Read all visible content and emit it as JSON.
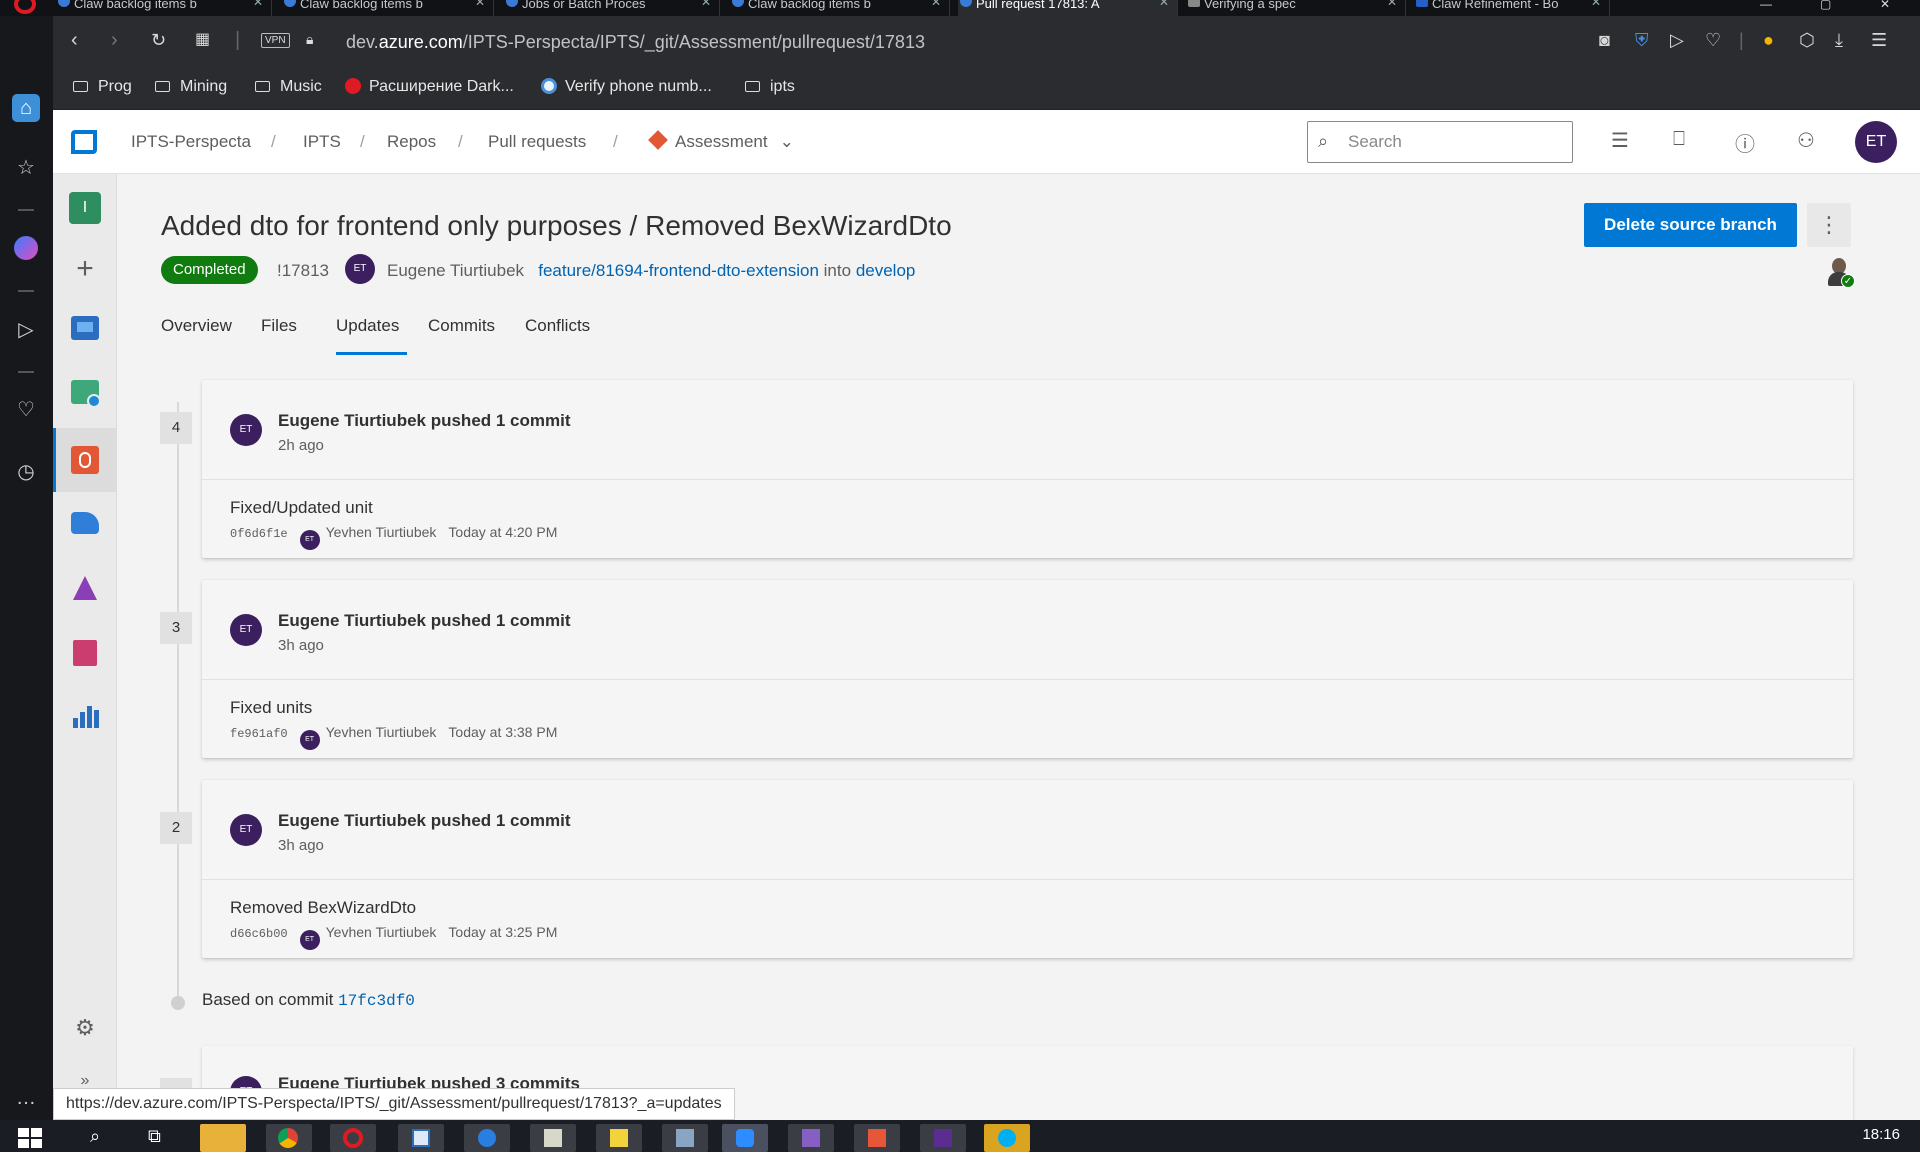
{
  "browser": {
    "tabs": [
      {
        "title": "Claw backlog items b"
      },
      {
        "title": "Claw backlog items b"
      },
      {
        "title": "Jobs or Batch Proces"
      },
      {
        "title": "Claw backlog items b"
      },
      {
        "title": "Pull request 17813: A"
      },
      {
        "title": "Verifying a spec"
      },
      {
        "title": "Claw Refinement - Bo"
      }
    ],
    "address": {
      "prefix": "dev.",
      "domain": "azure.com",
      "path": "/IPTS-Perspecta/IPTS/_git/Assessment/pullrequest/17813",
      "vpn_label": "VPN"
    },
    "bookmarks": [
      {
        "label": "Prog",
        "icon": "folder-icon"
      },
      {
        "label": "Mining",
        "icon": "folder-icon"
      },
      {
        "label": "Music",
        "icon": "folder-icon"
      },
      {
        "label": "Расширение Dark...",
        "icon": "opera-icon"
      },
      {
        "label": "Verify phone numb...",
        "icon": "telegram-icon"
      },
      {
        "label": "ipts",
        "icon": "folder-icon"
      }
    ],
    "status_url": "https://dev.azure.com/IPTS-Perspecta/IPTS/_git/Assessment/pullrequest/17813?_a=updates"
  },
  "header": {
    "breadcrumb": [
      "IPTS-Perspecta",
      "IPTS",
      "Repos",
      "Pull requests",
      "Assessment"
    ],
    "search_placeholder": "Search",
    "user_initials": "ET"
  },
  "nav": {
    "project_initial": "I"
  },
  "pr": {
    "title": "Added dto for frontend only purposes / Removed BexWizardDto",
    "status": "Completed",
    "id": "!17813",
    "author_initials": "ET",
    "author": "Eugene Tiurtiubek",
    "source_branch": "feature/81694-frontend-dto-extension",
    "into": "into",
    "target_branch": "develop",
    "delete_button": "Delete source branch",
    "more_label": "⋮"
  },
  "tabs": [
    "Overview",
    "Files",
    "Updates",
    "Commits",
    "Conflicts"
  ],
  "updates": [
    {
      "number": "4",
      "initials": "ET",
      "headline": "Eugene Tiurtiubek pushed 1 commit",
      "ago": "2h ago",
      "commit_message": "Fixed/Updated unit",
      "sha": "0f6d6f1e",
      "committer": "Yevhen Tiurtiubek",
      "when": "Today at 4:20 PM"
    },
    {
      "number": "3",
      "initials": "ET",
      "headline": "Eugene Tiurtiubek pushed 1 commit",
      "ago": "3h ago",
      "commit_message": "Fixed units",
      "sha": "fe961af0",
      "committer": "Yevhen Tiurtiubek",
      "when": "Today at 3:38 PM"
    },
    {
      "number": "2",
      "initials": "ET",
      "headline": "Eugene Tiurtiubek pushed 1 commit",
      "ago": "3h ago",
      "commit_message": "Removed BexWizardDto",
      "sha": "d66c6b00",
      "committer": "Yevhen Tiurtiubek",
      "when": "Today at 3:25 PM"
    }
  ],
  "based_on": {
    "label": "Based on commit",
    "sha": "17fc3df0"
  },
  "partial_update": {
    "initials": "ET",
    "headline": "Eugene Tiurtiubek pushed 3 commits"
  },
  "taskbar": {
    "clock": "18:16"
  },
  "colors": {
    "accent": "#0078d4",
    "completed": "#107c10",
    "avatar": "#3b1f5e"
  }
}
